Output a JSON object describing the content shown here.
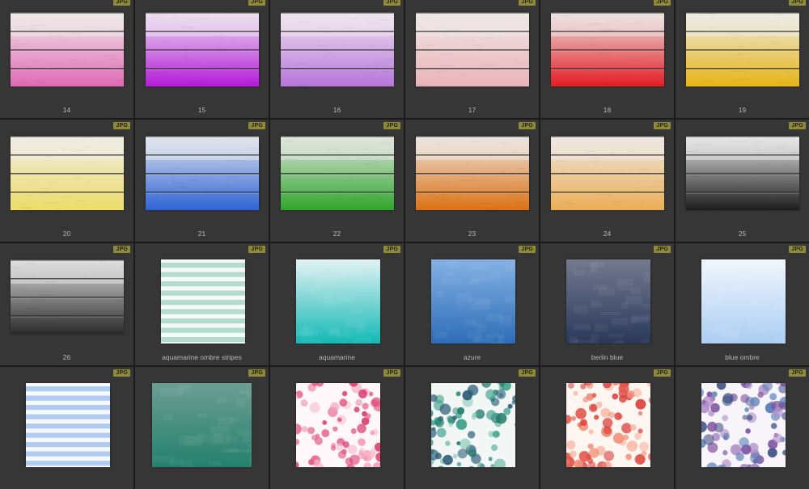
{
  "badge_label": "JPG",
  "items": [
    {
      "label": "14",
      "kind": "wood",
      "colors": [
        "#efe9e8",
        "#e06ab5"
      ]
    },
    {
      "label": "15",
      "kind": "wood",
      "colors": [
        "#ecdff0",
        "#b31cd8"
      ]
    },
    {
      "label": "16",
      "kind": "wood",
      "colors": [
        "#eee4f0",
        "#b775d8"
      ]
    },
    {
      "label": "17",
      "kind": "wood",
      "colors": [
        "#efe8e7",
        "#e9b3b8"
      ]
    },
    {
      "label": "18",
      "kind": "wood",
      "colors": [
        "#ece2e1",
        "#e41c22"
      ]
    },
    {
      "label": "19",
      "kind": "wood",
      "colors": [
        "#eeebe3",
        "#e6b514"
      ]
    },
    {
      "label": "20",
      "kind": "wood",
      "colors": [
        "#efece4",
        "#eedc6a"
      ]
    },
    {
      "label": "21",
      "kind": "wood",
      "colors": [
        "#e2e6ec",
        "#2e64d6"
      ]
    },
    {
      "label": "22",
      "kind": "wood",
      "colors": [
        "#e2e6df",
        "#2fa52c"
      ]
    },
    {
      "label": "23",
      "kind": "wood",
      "colors": [
        "#ece5df",
        "#dc7214"
      ]
    },
    {
      "label": "24",
      "kind": "wood",
      "colors": [
        "#eee8e0",
        "#ebae56"
      ]
    },
    {
      "label": "25",
      "kind": "wood",
      "colors": [
        "#e7e7e7",
        "#1c1c1c"
      ]
    },
    {
      "label": "26",
      "kind": "wood",
      "colors": [
        "#dfdfdf",
        "#2a2a2a"
      ]
    },
    {
      "label": "aquamarine ombre stripes",
      "kind": "stripes",
      "colors": [
        "#f5faf8",
        "#a6d6c6"
      ]
    },
    {
      "label": "aquamarine",
      "kind": "ombre",
      "colors": [
        "#e2f2f3",
        "#12b9b6"
      ]
    },
    {
      "label": "azure",
      "kind": "ombre",
      "colors": [
        "#84b1e4",
        "#2d6db7"
      ]
    },
    {
      "label": "berlin blue",
      "kind": "ombre",
      "colors": [
        "#74798f",
        "#29385a"
      ]
    },
    {
      "label": "blue ombre",
      "kind": "ombre",
      "colors": [
        "#f1f6fd",
        "#aacdf3"
      ]
    },
    {
      "label": "",
      "kind": "stripes",
      "colors": [
        "#f7f9fd",
        "#a4c4ee"
      ]
    },
    {
      "label": "",
      "kind": "ombre-tall",
      "colors": [
        "#6c9e92",
        "#23806c"
      ]
    },
    {
      "label": "",
      "kind": "dots",
      "colors": [
        "#fff7f9",
        "#e25a84",
        "#f2a0b8",
        "#f7c4d2",
        "#d83c6c"
      ]
    },
    {
      "label": "",
      "kind": "dots",
      "colors": [
        "#f2f7f5",
        "#1f7a6a",
        "#3da08a",
        "#86c7b4",
        "#2e5f7a"
      ]
    },
    {
      "label": "",
      "kind": "dots",
      "colors": [
        "#fff6f2",
        "#e3574a",
        "#f18f77",
        "#f6b6a2",
        "#d9403a"
      ]
    },
    {
      "label": "",
      "kind": "dots",
      "colors": [
        "#f7f4fa",
        "#7a4f9d",
        "#3c4f84",
        "#b190c9",
        "#5a7fb6"
      ]
    }
  ]
}
